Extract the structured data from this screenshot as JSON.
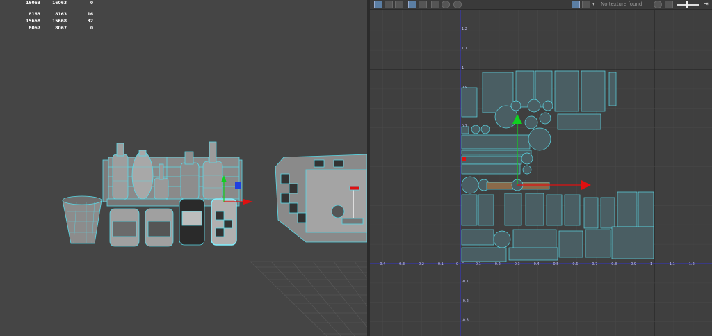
{
  "stats": {
    "rows": [
      [
        "16063",
        "16063",
        "0"
      ],
      [
        "8163",
        "8163",
        "16"
      ],
      [
        "15668",
        "15668",
        "32"
      ],
      [
        "8067",
        "8067",
        "0"
      ]
    ]
  },
  "uv_editor": {
    "texture_status": "No texture found",
    "v_ticks": [
      "1.2",
      "1.1",
      "1",
      "0.9",
      "0.8",
      "0.7",
      "0.6",
      "0.5",
      "0.4",
      "0.3",
      "0.2",
      "0.1",
      "0",
      "-0.1",
      "-0.2",
      "-0.3"
    ],
    "u_ticks": [
      "-0.4",
      "-0.3",
      "-0.2",
      "-0.1",
      "0",
      "0.1",
      "0.2",
      "0.3",
      "0.4",
      "0.5",
      "0.6",
      "0.7",
      "0.8",
      "0.9",
      "1",
      "1.1",
      "1.2"
    ],
    "toolbar_icons": [
      "uv-shell-icon",
      "uv-border-icon",
      "uv-distortion-icon",
      "grid-toggle-icon",
      "pixel-snap-icon",
      "checker-icon",
      "dim-image-icon",
      "image-display-icon",
      "checker-display-icon",
      "texture-dropdown-icon",
      "exposure-icon",
      "gamma-icon",
      "slider-icon"
    ]
  },
  "colors": {
    "wire": "#5ad8e6",
    "viewport_bg": "#454545",
    "uv_bg": "#3f3f3f",
    "axis_u": "#e01010",
    "axis_v": "#10d020",
    "grid_label": "#c8c8ff"
  }
}
